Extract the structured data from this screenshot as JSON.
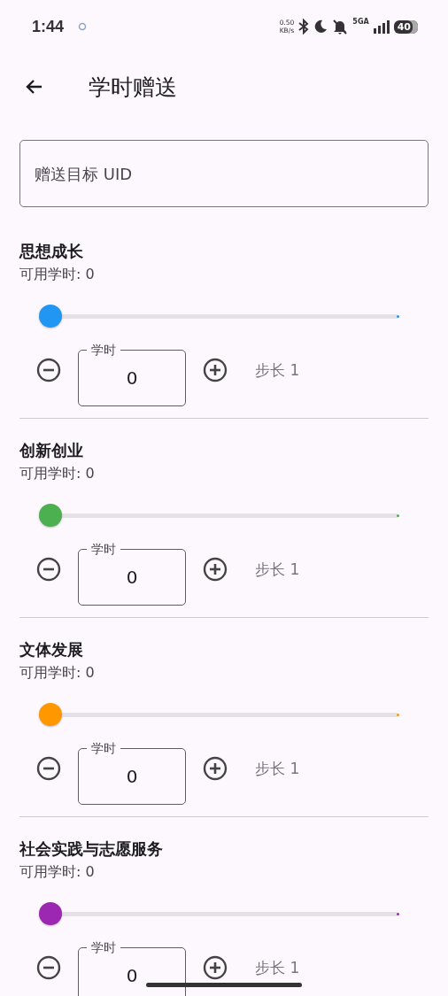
{
  "status_bar": {
    "time": "1:44",
    "net_speed": "0.50",
    "net_unit": "KB/s",
    "network": "5GA",
    "battery": "40"
  },
  "header": {
    "title": "学时赠送"
  },
  "uid_field": {
    "placeholder": "赠送目标 UID"
  },
  "categories": [
    {
      "title": "思想成长",
      "available": "可用学时: 0",
      "level": 0,
      "color": "#2196f3",
      "field_label": "学时",
      "value": "0",
      "step": "步长 1"
    },
    {
      "title": "创新创业",
      "available": "可用学时: 0",
      "level": 0,
      "color": "#4caf50",
      "field_label": "学时",
      "value": "0",
      "step": "步长 1"
    },
    {
      "title": "文体发展",
      "available": "可用学时: 0",
      "level": 0,
      "color": "#ff9800",
      "field_label": "学时",
      "value": "0",
      "step": "步长 1"
    },
    {
      "title": "社会实践与志愿服务",
      "available": "可用学时: 0",
      "level": 0,
      "color": "#9c27b0",
      "field_label": "学时",
      "value": "0",
      "step": "步长 1"
    }
  ]
}
